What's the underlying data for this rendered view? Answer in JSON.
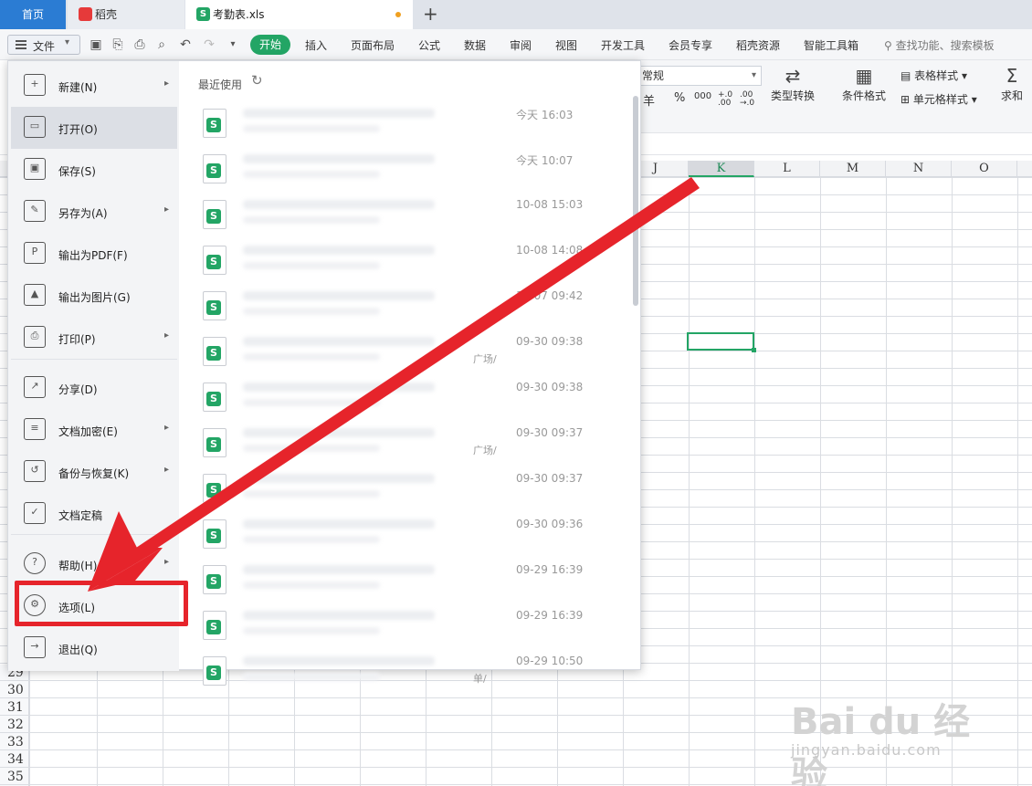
{
  "tabs": {
    "home": "首页",
    "daoke": "稻壳",
    "file": "考勤表.xls"
  },
  "ribbon": {
    "file_menu": "文件",
    "tabs": [
      "开始",
      "插入",
      "页面布局",
      "公式",
      "数据",
      "审阅",
      "视图",
      "开发工具",
      "会员专享",
      "稻壳资源",
      "智能工具箱"
    ],
    "search": "查找功能、搜索模板"
  },
  "toolbar": {
    "number_format": "常规",
    "currency": "羊",
    "percent": "%",
    "thousands": "000",
    "dec_inc": "+.0 .00",
    "dec_dec": ".00 →.0",
    "type_convert": "类型转换",
    "cond_format": "条件格式",
    "table_style": "表格样式",
    "cell_style": "单元格样式",
    "sum": "求和"
  },
  "sheet": {
    "columns": [
      "J",
      "K",
      "L",
      "M",
      "N",
      "O"
    ],
    "active_column": "K",
    "rows": [
      "29",
      "30",
      "31",
      "32",
      "33",
      "34",
      "35"
    ]
  },
  "file_menu": {
    "items": [
      {
        "label": "新建(N)",
        "icon": "new-doc-icon",
        "submenu": true
      },
      {
        "label": "打开(O)",
        "icon": "folder-icon",
        "submenu": false
      },
      {
        "label": "保存(S)",
        "icon": "save-icon",
        "submenu": false
      },
      {
        "label": "另存为(A)",
        "icon": "save-as-icon",
        "submenu": true
      },
      {
        "label": "输出为PDF(F)",
        "icon": "pdf-icon",
        "submenu": false
      },
      {
        "label": "输出为图片(G)",
        "icon": "image-icon",
        "submenu": false
      },
      {
        "label": "打印(P)",
        "icon": "print-icon",
        "submenu": true
      },
      {
        "label": "分享(D)",
        "icon": "share-icon",
        "submenu": false
      },
      {
        "label": "文档加密(E)",
        "icon": "encrypt-icon",
        "submenu": true
      },
      {
        "label": "备份与恢复(K)",
        "icon": "backup-icon",
        "submenu": true
      },
      {
        "label": "文档定稿",
        "icon": "finalize-icon",
        "submenu": false
      },
      {
        "label": "帮助(H)",
        "icon": "help-icon",
        "submenu": true
      },
      {
        "label": "选项(L)",
        "icon": "gear-icon",
        "submenu": false
      },
      {
        "label": "退出(Q)",
        "icon": "exit-icon",
        "submenu": false
      }
    ],
    "recent_title": "最近使用",
    "recent_files": [
      {
        "time": "今天  16:03",
        "path": ""
      },
      {
        "time": "今天  10:07",
        "path": ""
      },
      {
        "time": "10-08 15:03",
        "path": ""
      },
      {
        "time": "10-08 14:08",
        "path": ""
      },
      {
        "time": "10-07 09:42",
        "path": ""
      },
      {
        "time": "09-30 09:38",
        "path": "广场/"
      },
      {
        "time": "09-30 09:38",
        "path": ""
      },
      {
        "time": "09-30 09:37",
        "path": "广场/"
      },
      {
        "time": "09-30 09:37",
        "path": ""
      },
      {
        "time": "09-30 09:36",
        "path": ""
      },
      {
        "time": "09-29 16:39",
        "path": ""
      },
      {
        "time": "09-29 16:39",
        "path": ""
      },
      {
        "time": "09-29 10:50",
        "path": "单/"
      }
    ]
  },
  "watermark": {
    "main": "Bai du 经验",
    "sub": "jingyan.baidu.com"
  },
  "colors": {
    "accent_green": "#23a565",
    "home_tab_blue": "#2b7cd3",
    "annotation_red": "#e6242b"
  }
}
